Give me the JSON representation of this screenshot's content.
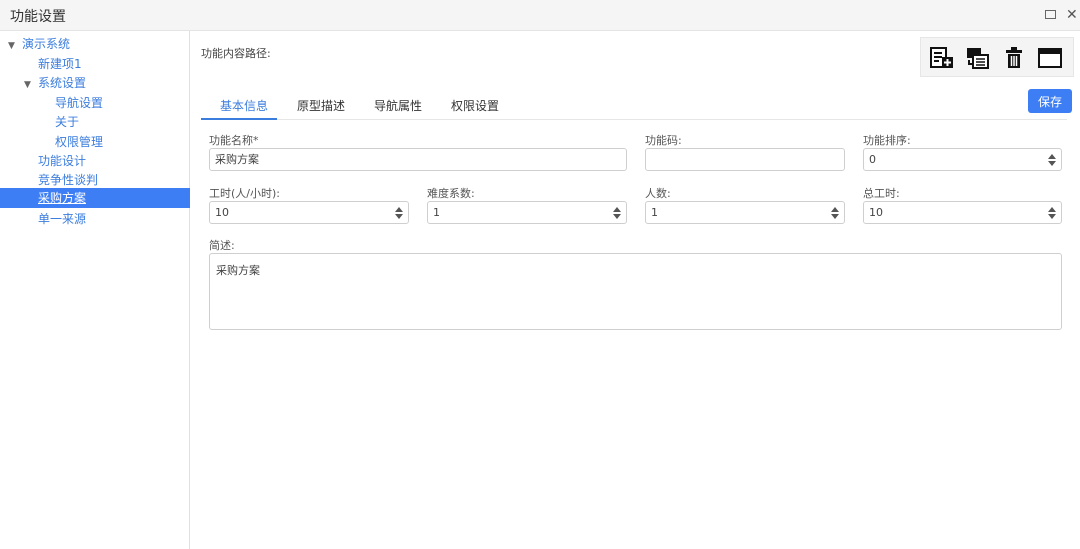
{
  "window": {
    "title": "功能设置"
  },
  "tree": {
    "items": [
      {
        "label": "演示系统",
        "expanded": true
      },
      {
        "label": "新建项1"
      },
      {
        "label": "系统设置",
        "expanded": true
      },
      {
        "label": "导航设置"
      },
      {
        "label": "关于"
      },
      {
        "label": "权限管理"
      },
      {
        "label": "功能设计"
      },
      {
        "label": "竞争性谈判"
      },
      {
        "label": "采购方案",
        "selected": true
      },
      {
        "label": "单一来源"
      }
    ]
  },
  "main": {
    "path_label": "功能内容路径:",
    "toolbar": {
      "icons": [
        "add-document-icon",
        "move-icon",
        "trash-icon",
        "window-icon"
      ]
    },
    "tabs": [
      {
        "label": "基本信息",
        "active": true
      },
      {
        "label": "原型描述"
      },
      {
        "label": "导航属性"
      },
      {
        "label": "权限设置"
      }
    ],
    "save_label": "保存",
    "form": {
      "name": {
        "label": "功能名称*",
        "value": "采购方案"
      },
      "code": {
        "label": "功能码:",
        "value": ""
      },
      "order": {
        "label": "功能排序:",
        "value": "0"
      },
      "hours": {
        "label": "工时(人/小时):",
        "value": "10"
      },
      "difficulty": {
        "label": "难度系数:",
        "value": "1"
      },
      "people": {
        "label": "人数:",
        "value": "1"
      },
      "total_hours": {
        "label": "总工时:",
        "value": "10"
      },
      "summary": {
        "label": "简述:",
        "value": "采购方案"
      }
    }
  },
  "colors": {
    "accent": "#3d7ef5",
    "link": "#3b7ddd"
  }
}
